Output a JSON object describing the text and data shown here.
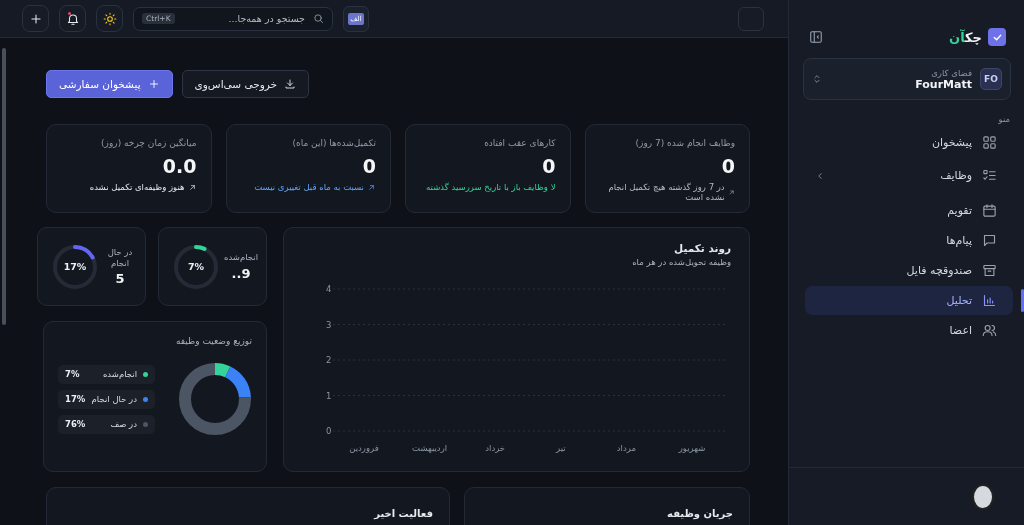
{
  "sidebar": {
    "logo": {
      "name": "چک",
      "accent": "آن"
    },
    "workspace": {
      "label": "فضای کاری",
      "name": "FourMatt",
      "initials": "FO"
    },
    "section_label": "منو",
    "items": [
      {
        "label": "پیشخوان",
        "kind": "link",
        "selected": false
      },
      {
        "label": "وظایف",
        "kind": "group",
        "selected": false
      },
      {
        "label": "تقویم",
        "kind": "link",
        "selected": false
      },
      {
        "label": "پیام‌ها",
        "kind": "link",
        "selected": false
      },
      {
        "label": "صندوقچه فایل",
        "kind": "link",
        "selected": false
      },
      {
        "label": "تحلیل",
        "kind": "link",
        "selected": true
      },
      {
        "label": "اعضا",
        "kind": "link",
        "selected": false
      }
    ]
  },
  "topbar": {
    "language": "الف",
    "search": {
      "placeholder": "جستجو در همه‌جا...",
      "shortcut": "Ctrl+K"
    },
    "notifications": {
      "unread": true
    }
  },
  "actions": [
    {
      "label": "خروجی سی‌اس‌وی",
      "kind": "secondary"
    },
    {
      "label": "پیشخوان سفارشی",
      "kind": "primary"
    }
  ],
  "stats": [
    {
      "title": "وظایف انجام شده (7 روز)",
      "value": "0",
      "note": "در 7 روز گذشته هیچ تکمیل انجام نشده است",
      "kind": "muted",
      "arrow": true
    },
    {
      "title": "کارهای عقب افتاده",
      "value": "0",
      "note": "لا وظایف باز با تاریخ سررسید گذشته",
      "kind": "success",
      "arrow": false
    },
    {
      "title": "تکمیل‌شده‌ها (این ماه)",
      "value": "0",
      "note": "نسبت به ماه قبل تغییری نیست",
      "kind": "info",
      "arrow": true
    },
    {
      "title": "میانگین زمان چرخه (روز)",
      "value": "0.0",
      "note": "هنوز وظیفه‌ای تکمیل نشده",
      "kind": "default",
      "arrow": true
    }
  ],
  "trend": {
    "subtitle": "وظیفه تحویل‌شده در هر ماه",
    "chart_data": {
      "type": "line",
      "title": "روند تکمیل",
      "categories": [
        "فروردین",
        "اردیبهشت",
        "خرداد",
        "تیر",
        "مرداد",
        "شهریور"
      ],
      "ylim": [
        0,
        4
      ],
      "grid": true,
      "yticks": [
        0,
        1,
        2,
        3,
        4
      ]
    }
  },
  "gauges": [
    {
      "label": "انجام‌شده",
      "value": "9..",
      "percent": "7%",
      "level": 0.07,
      "color": "#34d399"
    },
    {
      "label": "در حال انجام",
      "value": "5",
      "percent": "17%",
      "level": 0.17,
      "color": "#6366f1"
    }
  ],
  "distribution": {
    "title": "توزیع وضعیت وظیفه",
    "items": [
      {
        "label": "انجام‌شده",
        "percent": "7%",
        "level": 0.07,
        "color": "#34d399"
      },
      {
        "label": "در حال انجام",
        "percent": "17%",
        "level": 0.17,
        "color": "#3b82f6"
      },
      {
        "label": "در صف",
        "percent": "76%",
        "level": 0.76,
        "color": "#4b5563"
      }
    ]
  },
  "panels": [
    {
      "title": "جریان وظیفه"
    },
    {
      "title": "فعالیت اخیر"
    }
  ]
}
